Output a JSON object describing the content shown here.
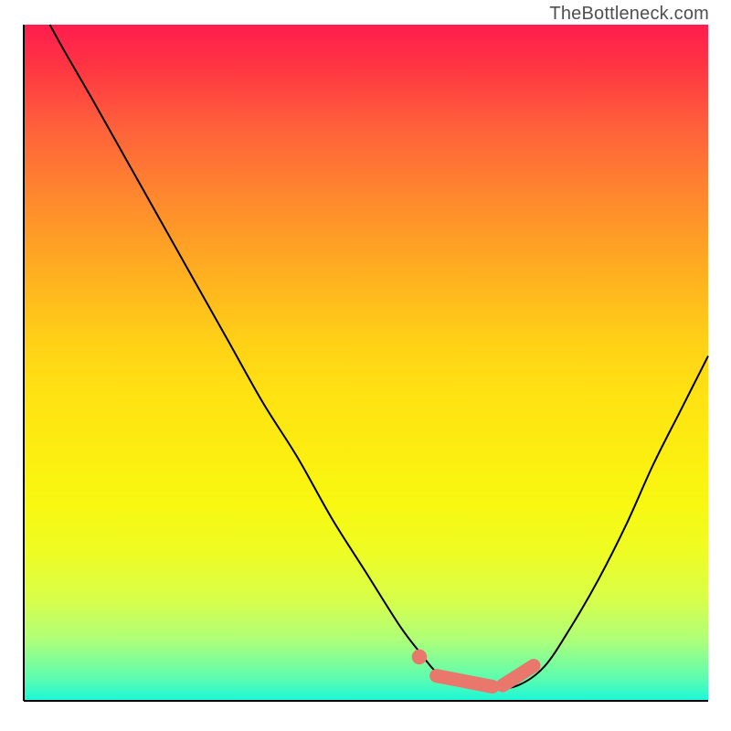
{
  "watermark": "TheBottleneck.com",
  "colors": {
    "curve": "#000000",
    "marker_fill": "#e9776b",
    "axis": "#000000",
    "gradient_top": "#ff1e4e",
    "gradient_bottom": "#1bf7da"
  },
  "chart_data": {
    "type": "line",
    "title": "",
    "xlabel": "",
    "ylabel": "",
    "xlim": [
      0,
      100
    ],
    "ylim": [
      0,
      100
    ],
    "series": [
      {
        "name": "bottleneck-curve",
        "x": [
          3.8,
          6,
          10,
          15,
          20,
          25,
          30,
          35,
          40,
          45,
          50,
          55,
          58,
          60,
          62,
          64,
          66,
          68,
          72,
          76,
          80,
          84,
          88,
          92,
          96,
          100
        ],
        "y": [
          100,
          96,
          89,
          80,
          71,
          62,
          53,
          44,
          36,
          27,
          19,
          11,
          7,
          4.5,
          3,
          2.2,
          1.8,
          1.8,
          2.2,
          5,
          11,
          18,
          26,
          35,
          43,
          51
        ]
      }
    ],
    "markers": {
      "name": "highlighted-minimum",
      "color": "#e9776b",
      "segments": [
        {
          "type": "dot",
          "x": 57.8,
          "y": 6.5,
          "r": 1.1
        },
        {
          "type": "stroke",
          "x0": 60.3,
          "y0": 3.7,
          "x1": 68.5,
          "y1": 2.1,
          "w": 2.0
        },
        {
          "type": "stroke",
          "x0": 70,
          "y0": 2.3,
          "x1": 74.5,
          "y1": 5.2,
          "w": 2.0
        },
        {
          "type": "dot",
          "x": 70,
          "y": 2.1,
          "r": 0.8
        }
      ]
    }
  }
}
